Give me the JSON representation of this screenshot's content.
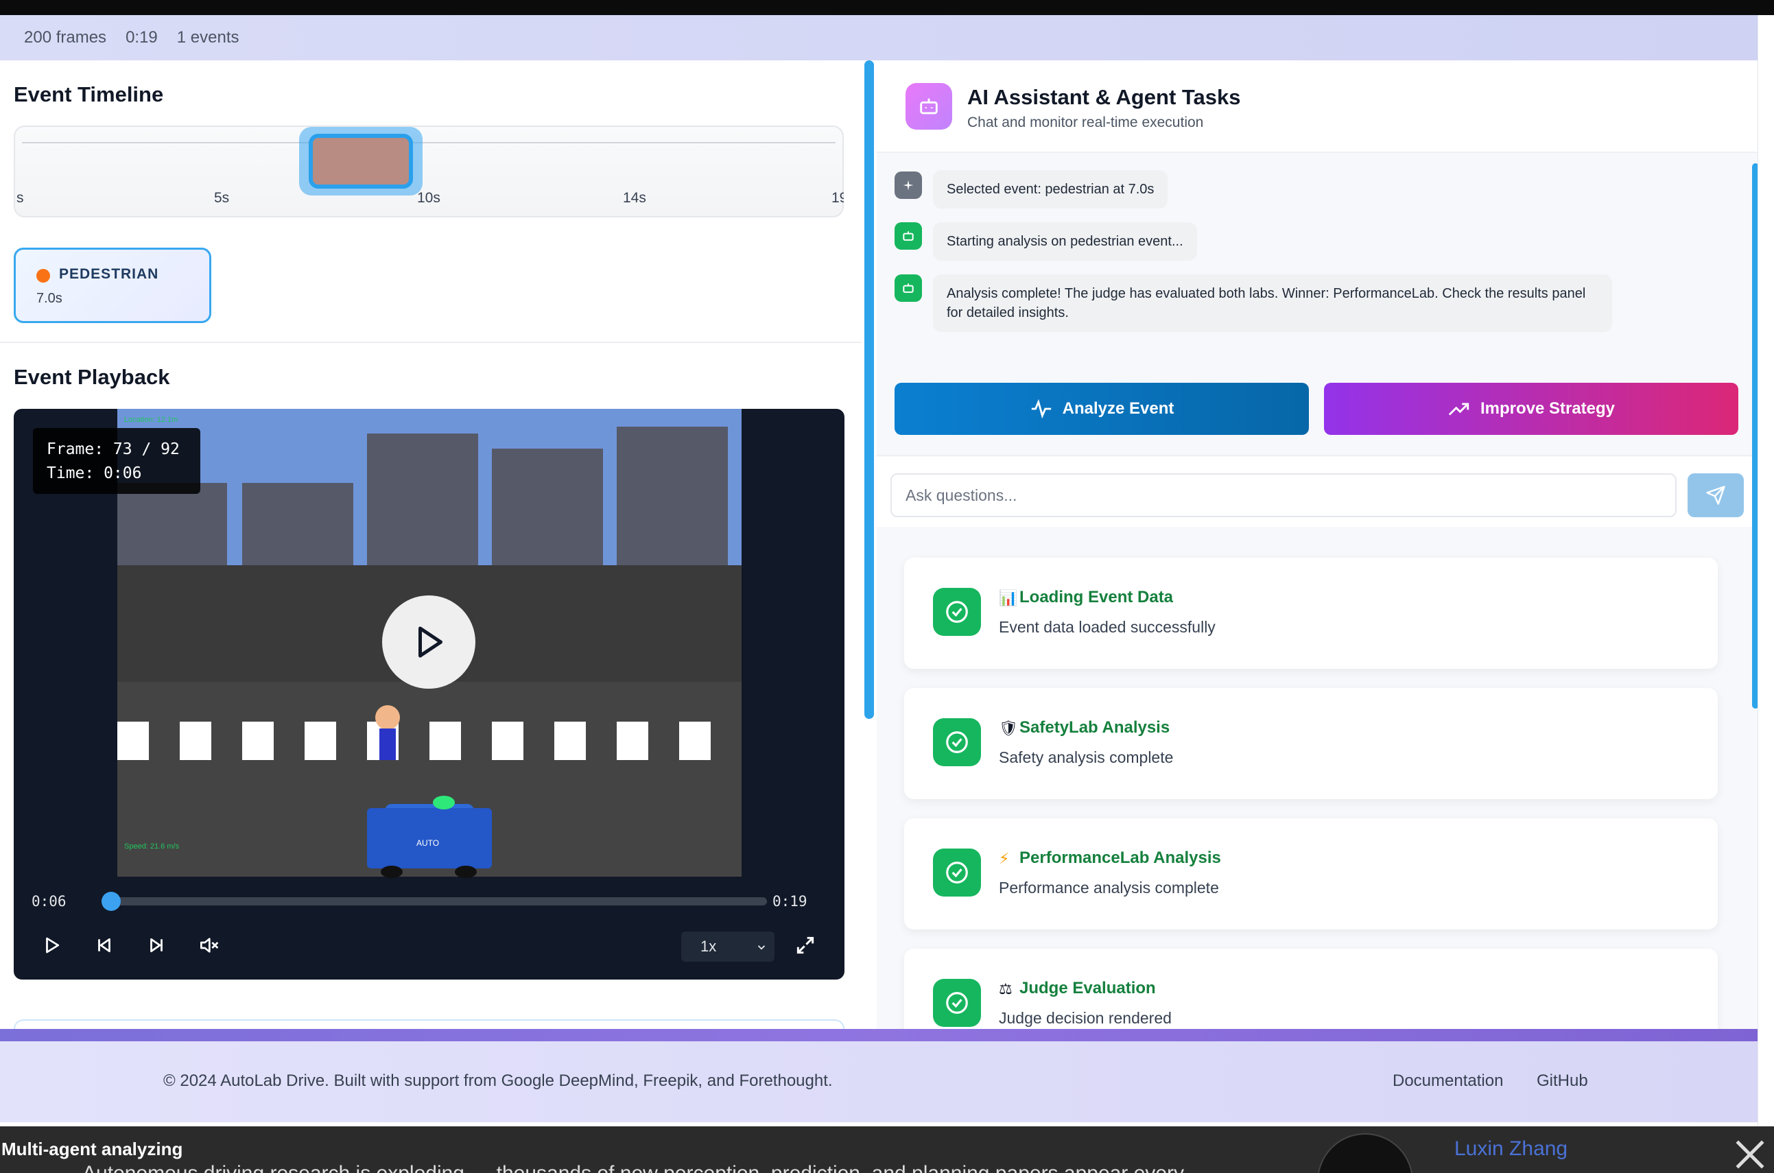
{
  "stats": {
    "frames": "200 frames",
    "duration": "0:19",
    "events": "1 events"
  },
  "timeline": {
    "title": "Event Timeline",
    "ticks": [
      "s",
      "5s",
      "10s",
      "14s",
      "19"
    ]
  },
  "event_card": {
    "label": "PEDESTRIAN",
    "time": "7.0s",
    "dot_color": "#f97316"
  },
  "playback": {
    "title": "Event Playback",
    "frame_line": "Frame: 73 / 92",
    "time_line": "Time: 0:06",
    "current_time": "0:06",
    "total_time": "0:19",
    "progress": 0.0,
    "speed": "1x",
    "car_label": "AUTO",
    "hud_speed": "Speed: 21.6 m/s",
    "hud_top": "Location: 12.1m"
  },
  "assistant": {
    "title": "AI Assistant & Agent Tasks",
    "subtitle": "Chat and monitor real-time execution",
    "messages": [
      {
        "text": "Selected event: pedestrian at 7.0s",
        "icon": "sparkle-icon"
      },
      {
        "text": "Starting analysis on pedestrian event...",
        "icon": "robot-icon"
      },
      {
        "text": "Analysis complete! The judge has evaluated both labs. Winner: PerformanceLab. Check the results panel for detailed insights.",
        "icon": "robot-icon"
      }
    ],
    "analyze_label": "Analyze Event",
    "improve_label": "Improve Strategy",
    "ask_placeholder": "Ask questions...",
    "tasks": [
      {
        "emoji": "📊",
        "title": "Loading Event Data",
        "status": "Event data loaded successfully"
      },
      {
        "emoji": "🛡",
        "title": "SafetyLab Analysis",
        "status": "Safety analysis complete"
      },
      {
        "emoji": "⚡",
        "title": "PerformanceLab Analysis",
        "status": "Performance analysis complete"
      },
      {
        "emoji": "⚖",
        "title": "Judge Evaluation",
        "status": "Judge decision rendered"
      }
    ]
  },
  "footer": {
    "copyright": "© 2024 AutoLab Drive.  Built with support from Google DeepMind, Freepik, and Forethought.",
    "links": [
      "Documentation",
      "GitHub"
    ]
  },
  "overlay": {
    "title": "Multi-agent analyzing",
    "body": "Autonomous driving research is exploding — thousands of new perception, prediction, and planning papers appear every",
    "author": "Luxin Zhang"
  },
  "colors": {
    "accent": "#2da3ea",
    "success": "#16b65e",
    "analyze_from": "#0b7fd1",
    "improve_from": "#9333ea",
    "improve_to": "#db2777"
  }
}
